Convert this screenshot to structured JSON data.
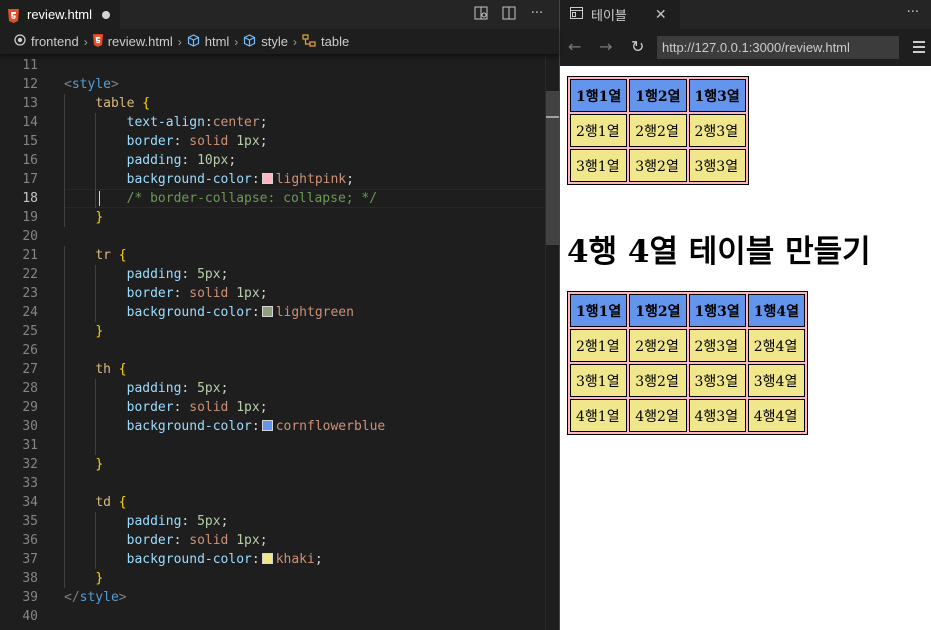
{
  "editor": {
    "tab": {
      "filename": "review.html",
      "icon": "html5-icon",
      "modified": true
    },
    "actions": [
      "open-preview-icon",
      "split-editor-icon",
      "more-actions-icon"
    ],
    "breadcrumb": [
      "frontend",
      "review.html",
      "html",
      "style",
      "table"
    ],
    "current_line": 18,
    "lines": [
      {
        "n": 11,
        "tokens": []
      },
      {
        "n": 12,
        "tokens": [
          [
            "t-tag",
            "<"
          ],
          [
            "t-name",
            "style"
          ],
          [
            "t-tag",
            ">"
          ]
        ]
      },
      {
        "n": 13,
        "tokens": [
          [
            "t-pun",
            "    "
          ],
          [
            "t-sel",
            "table"
          ],
          [
            "t-pun",
            " "
          ],
          [
            "t-brace",
            "{"
          ]
        ]
      },
      {
        "n": 14,
        "tokens": [
          [
            "t-pun",
            "        "
          ],
          [
            "t-prop",
            "text-align"
          ],
          [
            "t-pun",
            ":"
          ],
          [
            "t-val",
            "center"
          ],
          [
            "t-pun",
            ";"
          ]
        ]
      },
      {
        "n": 15,
        "tokens": [
          [
            "t-pun",
            "        "
          ],
          [
            "t-prop",
            "border"
          ],
          [
            "t-pun",
            ": "
          ],
          [
            "t-val",
            "solid"
          ],
          [
            "t-pun",
            " "
          ],
          [
            "t-num",
            "1px"
          ],
          [
            "t-pun",
            ";"
          ]
        ]
      },
      {
        "n": 16,
        "tokens": [
          [
            "t-pun",
            "        "
          ],
          [
            "t-prop",
            "padding"
          ],
          [
            "t-pun",
            ": "
          ],
          [
            "t-num",
            "10px"
          ],
          [
            "t-pun",
            ";"
          ]
        ]
      },
      {
        "n": 17,
        "tokens": [
          [
            "t-pun",
            "        "
          ],
          [
            "t-prop",
            "background-color"
          ],
          [
            "t-pun",
            ":"
          ],
          [
            "swatch",
            "#ffb6c1"
          ],
          [
            "t-val",
            "lightpink"
          ],
          [
            "t-pun",
            ";"
          ]
        ]
      },
      {
        "n": 18,
        "tokens": [
          [
            "t-pun",
            "        "
          ],
          [
            "t-com",
            "/* border-collapse: collapse; */"
          ]
        ]
      },
      {
        "n": 19,
        "tokens": [
          [
            "t-pun",
            "    "
          ],
          [
            "t-brace",
            "}"
          ]
        ]
      },
      {
        "n": 20,
        "tokens": []
      },
      {
        "n": 21,
        "tokens": [
          [
            "t-pun",
            "    "
          ],
          [
            "t-sel",
            "tr"
          ],
          [
            "t-pun",
            " "
          ],
          [
            "t-brace",
            "{"
          ]
        ]
      },
      {
        "n": 22,
        "tokens": [
          [
            "t-pun",
            "        "
          ],
          [
            "t-prop",
            "padding"
          ],
          [
            "t-pun",
            ": "
          ],
          [
            "t-num",
            "5px"
          ],
          [
            "t-pun",
            ";"
          ]
        ]
      },
      {
        "n": 23,
        "tokens": [
          [
            "t-pun",
            "        "
          ],
          [
            "t-prop",
            "border"
          ],
          [
            "t-pun",
            ": "
          ],
          [
            "t-val",
            "solid"
          ],
          [
            "t-pun",
            " "
          ],
          [
            "t-num",
            "1px"
          ],
          [
            "t-pun",
            ";"
          ]
        ]
      },
      {
        "n": 24,
        "tokens": [
          [
            "t-pun",
            "        "
          ],
          [
            "t-prop",
            "background-color"
          ],
          [
            "t-pun",
            ":"
          ],
          [
            "swatch",
            "#8fa07a"
          ],
          [
            "t-val",
            "lightgreen"
          ]
        ]
      },
      {
        "n": 25,
        "tokens": [
          [
            "t-pun",
            "    "
          ],
          [
            "t-brace",
            "}"
          ]
        ]
      },
      {
        "n": 26,
        "tokens": []
      },
      {
        "n": 27,
        "tokens": [
          [
            "t-pun",
            "    "
          ],
          [
            "t-sel",
            "th"
          ],
          [
            "t-pun",
            " "
          ],
          [
            "t-brace",
            "{"
          ]
        ]
      },
      {
        "n": 28,
        "tokens": [
          [
            "t-pun",
            "        "
          ],
          [
            "t-prop",
            "padding"
          ],
          [
            "t-pun",
            ": "
          ],
          [
            "t-num",
            "5px"
          ],
          [
            "t-pun",
            ";"
          ]
        ]
      },
      {
        "n": 29,
        "tokens": [
          [
            "t-pun",
            "        "
          ],
          [
            "t-prop",
            "border"
          ],
          [
            "t-pun",
            ": "
          ],
          [
            "t-val",
            "solid"
          ],
          [
            "t-pun",
            " "
          ],
          [
            "t-num",
            "1px"
          ],
          [
            "t-pun",
            ";"
          ]
        ]
      },
      {
        "n": 30,
        "tokens": [
          [
            "t-pun",
            "        "
          ],
          [
            "t-prop",
            "background-color"
          ],
          [
            "t-pun",
            ":"
          ],
          [
            "swatch",
            "#6495ed"
          ],
          [
            "t-val",
            "cornflowerblue"
          ]
        ]
      },
      {
        "n": 31,
        "tokens": []
      },
      {
        "n": 32,
        "tokens": [
          [
            "t-pun",
            "    "
          ],
          [
            "t-brace",
            "}"
          ]
        ]
      },
      {
        "n": 33,
        "tokens": []
      },
      {
        "n": 34,
        "tokens": [
          [
            "t-pun",
            "    "
          ],
          [
            "t-sel",
            "td"
          ],
          [
            "t-pun",
            " "
          ],
          [
            "t-brace",
            "{"
          ]
        ]
      },
      {
        "n": 35,
        "tokens": [
          [
            "t-pun",
            "        "
          ],
          [
            "t-prop",
            "padding"
          ],
          [
            "t-pun",
            ": "
          ],
          [
            "t-num",
            "5px"
          ],
          [
            "t-pun",
            ";"
          ]
        ]
      },
      {
        "n": 36,
        "tokens": [
          [
            "t-pun",
            "        "
          ],
          [
            "t-prop",
            "border"
          ],
          [
            "t-pun",
            ": "
          ],
          [
            "t-val",
            "solid"
          ],
          [
            "t-pun",
            " "
          ],
          [
            "t-num",
            "1px"
          ],
          [
            "t-pun",
            ";"
          ]
        ]
      },
      {
        "n": 37,
        "tokens": [
          [
            "t-pun",
            "        "
          ],
          [
            "t-prop",
            "background-color"
          ],
          [
            "t-pun",
            ":"
          ],
          [
            "swatch",
            "#f0e68c"
          ],
          [
            "t-val",
            "khaki"
          ],
          [
            "t-pun",
            ";"
          ]
        ]
      },
      {
        "n": 38,
        "tokens": [
          [
            "t-pun",
            "    "
          ],
          [
            "t-brace",
            "}"
          ]
        ]
      },
      {
        "n": 39,
        "tokens": [
          [
            "t-tag",
            "</"
          ],
          [
            "t-name",
            "style"
          ],
          [
            "t-tag",
            ">"
          ]
        ]
      },
      {
        "n": 40,
        "tokens": []
      }
    ]
  },
  "preview": {
    "tab_title": "테이블",
    "url": "http://127.0.0.1:3000/review.html",
    "table1": {
      "header": [
        "1행1열",
        "1행2열",
        "1행3열"
      ],
      "rows": [
        [
          "2행1열",
          "2행2열",
          "2행3열"
        ],
        [
          "3행1열",
          "3행2열",
          "3행3열"
        ]
      ]
    },
    "heading": "4행 4열 테이블 만들기",
    "table2": {
      "header": [
        "1행1열",
        "1행2열",
        "1행3열",
        "1행4열"
      ],
      "rows": [
        [
          "2행1열",
          "2행2열",
          "2행3열",
          "2행4열"
        ],
        [
          "3행1열",
          "3행2열",
          "3행3열",
          "3행4열"
        ],
        [
          "4행1열",
          "4행2열",
          "4행3열",
          "4행4열"
        ]
      ]
    }
  },
  "colors": {
    "lightpink": "#ffb6c1",
    "cornflowerblue": "#6495ed",
    "khaki": "#f0e68c",
    "html_icon": "#e44d26",
    "breadcrumb_html": "#75beff",
    "breadcrumb_style": "#e8a33d"
  }
}
